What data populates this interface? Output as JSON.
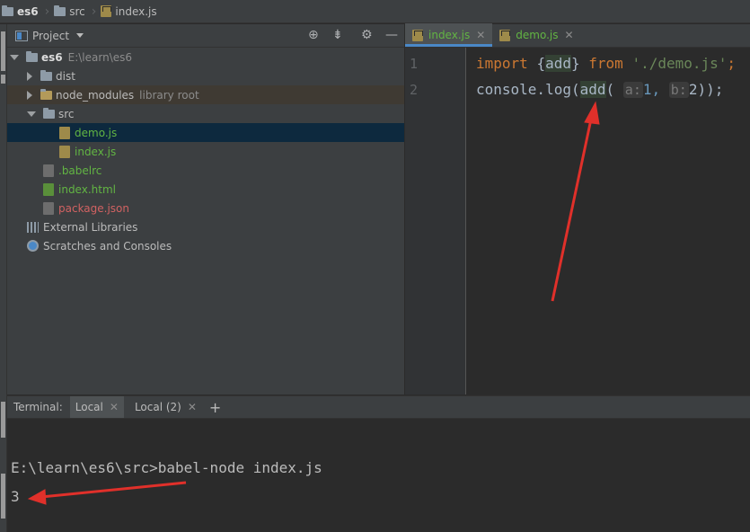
{
  "breadcrumb": {
    "items": [
      {
        "label": "es6",
        "icon": "folder-icon"
      },
      {
        "label": "src",
        "icon": "folder-icon"
      },
      {
        "label": "index.js",
        "icon": "js-file-icon"
      }
    ]
  },
  "project_panel": {
    "title": "Project",
    "tree": [
      {
        "label": "es6",
        "note": "E:\\learn\\es6",
        "type": "folder",
        "expanded": true
      },
      {
        "label": "dist",
        "type": "folder",
        "expanded": false
      },
      {
        "label": "node_modules",
        "note": "library root",
        "type": "folder",
        "expanded": false
      },
      {
        "label": "src",
        "type": "folder",
        "expanded": true
      },
      {
        "label": "demo.js",
        "type": "js"
      },
      {
        "label": "index.js",
        "type": "js"
      },
      {
        "label": ".babelrc",
        "type": "babel"
      },
      {
        "label": "index.html",
        "type": "html"
      },
      {
        "label": "package.json",
        "type": "json"
      },
      {
        "label": "External Libraries",
        "type": "libs"
      },
      {
        "label": "Scratches and Consoles",
        "type": "scratch"
      }
    ]
  },
  "editor": {
    "tabs": [
      {
        "label": "index.js",
        "active": true
      },
      {
        "label": "demo.js",
        "active": false
      }
    ],
    "lines": [
      {
        "num": "1",
        "import": "import",
        "brace_open": "{",
        "name": "add",
        "brace_close": "}",
        "from": "from",
        "path": "'./demo.js'",
        "semi": ";"
      },
      {
        "num": "2",
        "obj": "console.",
        "method": "log",
        "paren1": "(",
        "fn": "add",
        "paren2": "(",
        "hint_a": "a:",
        "arg1": "1,",
        "hint_b": "b:",
        "arg2": "2));"
      }
    ]
  },
  "terminal": {
    "label": "Terminal:",
    "tabs": [
      "Local",
      "Local (2)"
    ],
    "add_label": "+",
    "lines": [
      "E:\\learn\\es6\\src>babel-node index.js",
      "3"
    ]
  },
  "colors": {
    "annotation_arrow": "#e0302a",
    "selection": "#0d293e",
    "tab_underline": "#4a88c7"
  }
}
